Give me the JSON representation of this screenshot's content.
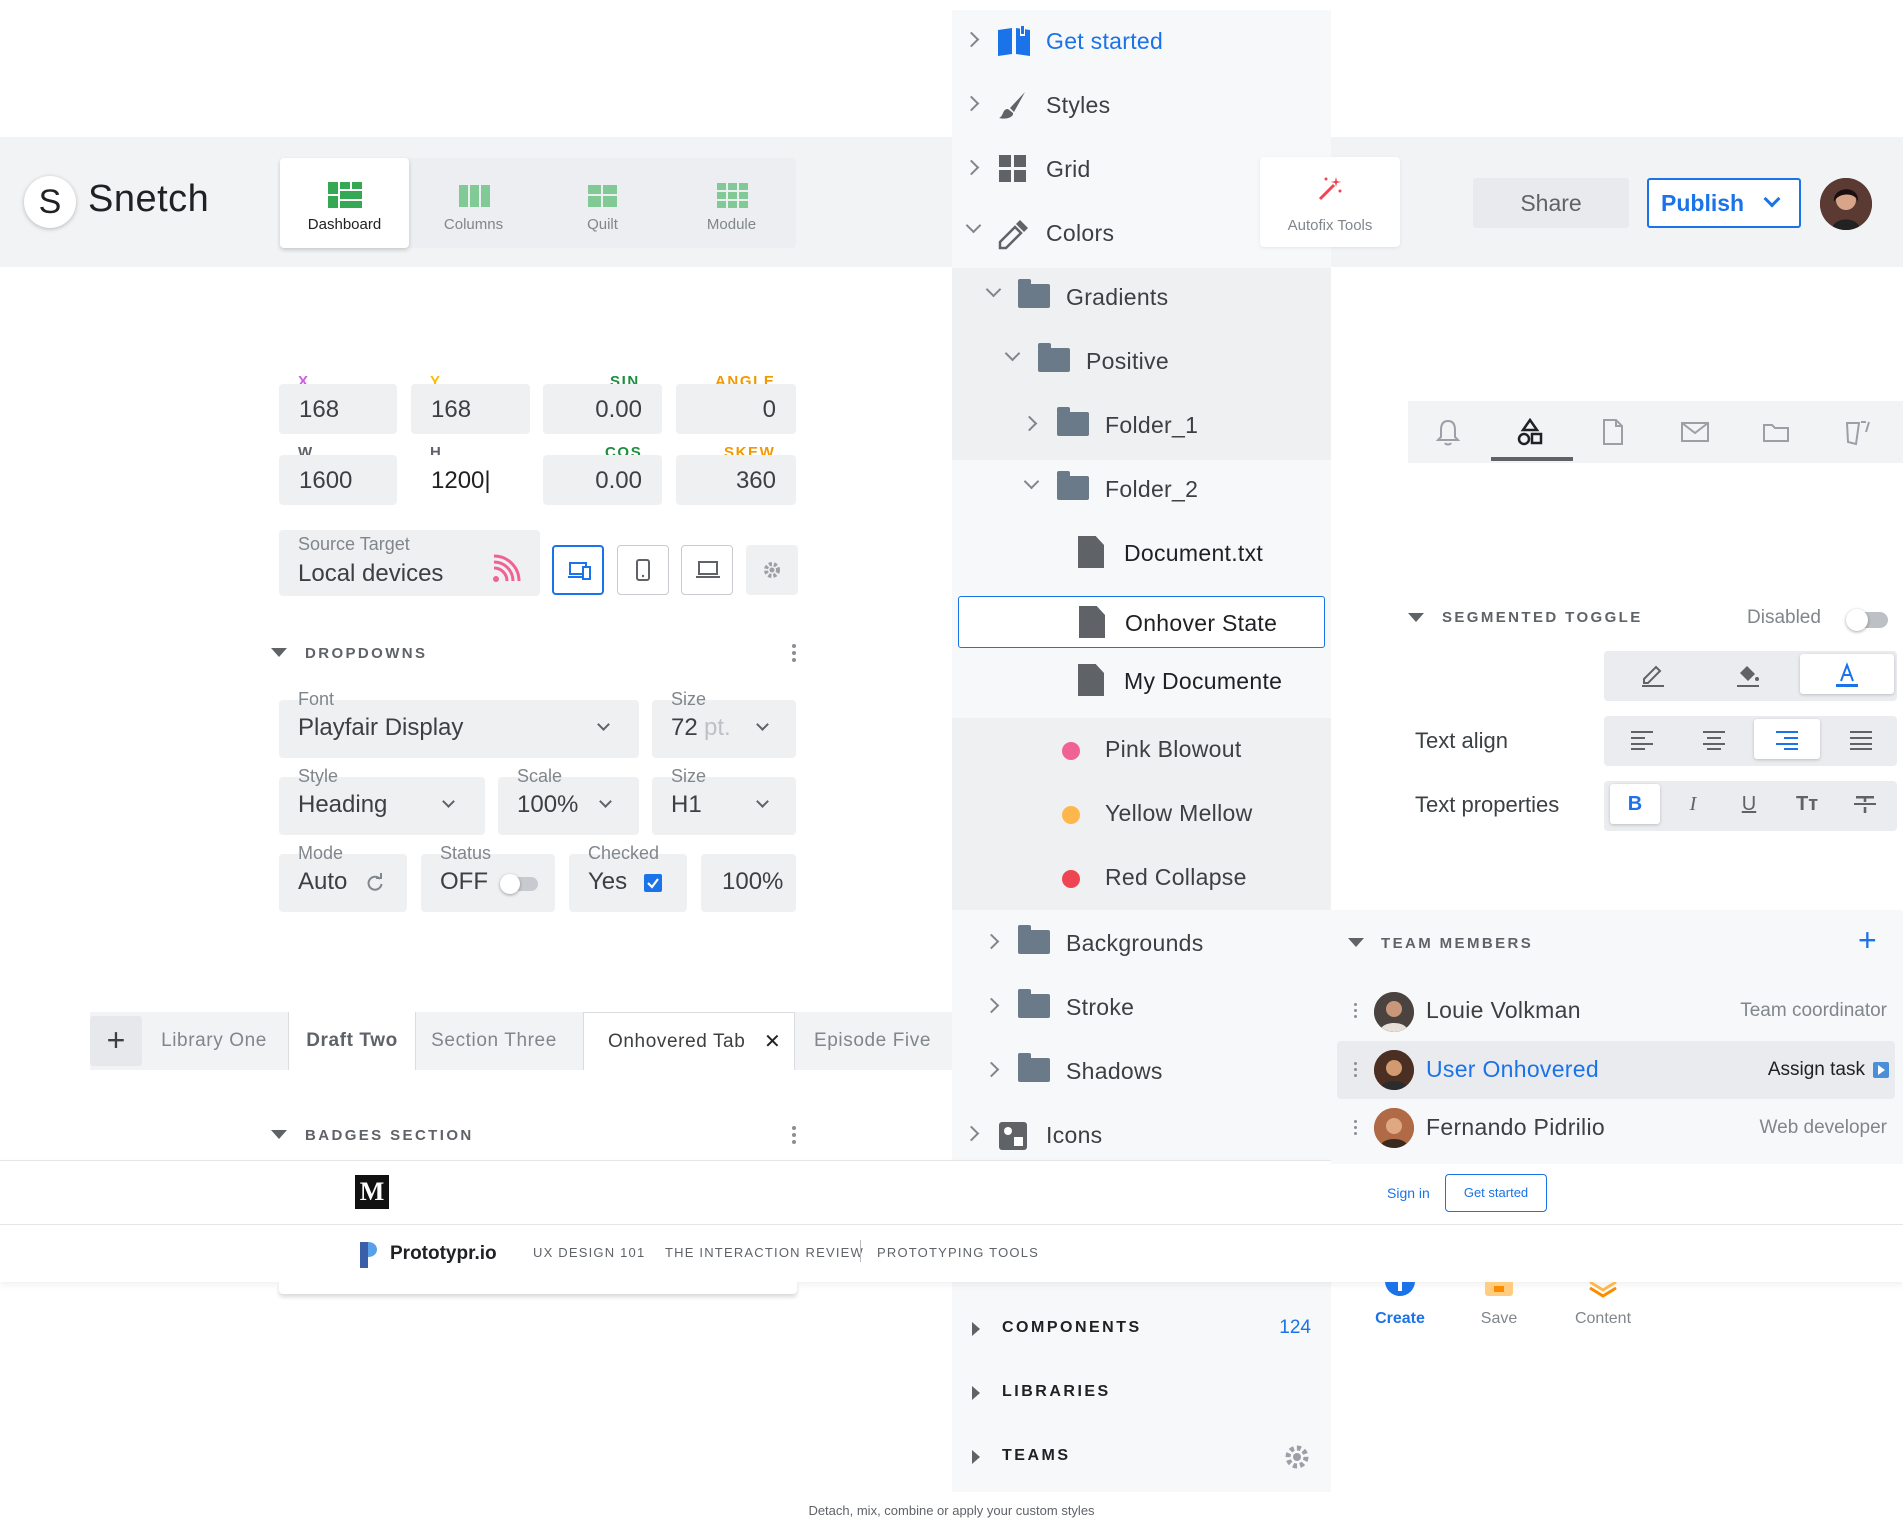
{
  "app": {
    "logo_letter": "S",
    "name": "Snetch"
  },
  "view_tabs": [
    {
      "label": "Dashboard",
      "icon": "dashboard-icon"
    },
    {
      "label": "Columns",
      "icon": "columns-icon"
    },
    {
      "label": "Quilt",
      "icon": "quilt-icon"
    },
    {
      "label": "Module",
      "icon": "module-icon"
    }
  ],
  "transform": {
    "x_label": "X",
    "x": "168",
    "y_label": "Y",
    "y": "168",
    "sin_label": "SIN",
    "sin": "0.00",
    "angle_label": "ANGLE",
    "angle": "0",
    "w_label": "W",
    "w": "1600",
    "h_label": "H",
    "h": "1200|",
    "cos_label": "COS",
    "cos": "0.00",
    "skew_label": "SKEW",
    "skew": "360"
  },
  "source": {
    "label": "Source Target",
    "value": "Local devices"
  },
  "dropdowns": {
    "title": "DROPDOWNS",
    "font_label": "Font",
    "font": "Playfair Display",
    "size_label": "Size",
    "size": "72",
    "size_unit": "pt.",
    "style_label": "Style",
    "style": "Heading",
    "scale_label": "Scale",
    "scale": "100%",
    "size2_label": "Size",
    "size2": "H1",
    "mode_label": "Mode",
    "mode": "Auto",
    "status_label": "Status",
    "status": "OFF",
    "checked_label": "Checked",
    "checked": "Yes",
    "percent": "100%"
  },
  "tabs": {
    "items": [
      "Library One",
      "Draft Two",
      "Section Three",
      "Onhovered Tab",
      "Episode Five"
    ],
    "close": "✕",
    "add": "+"
  },
  "badges": {
    "title": "BADGES SECTION"
  },
  "tree": {
    "get_started": "Get started",
    "styles": "Styles",
    "grid": "Grid",
    "colors": "Colors",
    "gradients": "Gradients",
    "positive": "Positive",
    "folder1": "Folder_1",
    "folder2": "Folder_2",
    "doc_txt": "Document.txt",
    "onhover": "Onhover State",
    "my_doc": "My Documente",
    "pink": "Pink Blowout",
    "yellow": "Yellow Mellow",
    "red": "Red Collapse",
    "backgrounds": "Backgrounds",
    "stroke": "Stroke",
    "shadows": "Shadows",
    "icons": "Icons",
    "components": "COMPONENTS",
    "components_count": "124",
    "libraries": "LIBRARIES",
    "teams": "TEAMS"
  },
  "colors": {
    "pink": "#f06292",
    "yellow": "#ffb74d",
    "red": "#ef4452",
    "blue": "#1a73e8",
    "green": "#34a853"
  },
  "toolbar": {
    "autofix": "Autofix Tools",
    "share": "Share",
    "publish": "Publish"
  },
  "segmented": {
    "title": "SEGMENTED TOGGLE",
    "disabled": "Disabled",
    "text_align": "Text align",
    "text_props": "Text properties",
    "bold": "B",
    "italic": "I",
    "underline": "U",
    "size": "Tт"
  },
  "team": {
    "title": "TEAM MEMBERS",
    "add": "+",
    "members": [
      {
        "name": "Louie Volkman",
        "role": "Team coordinator"
      },
      {
        "name": "User Onhovered",
        "role": "Assign task"
      },
      {
        "name": "Fernando Pidrilio",
        "role": "Web developer"
      }
    ]
  },
  "actions": [
    "Create",
    "Save",
    "Content"
  ],
  "medium": {
    "logo": "M",
    "sign_in": "Sign in",
    "get_started": "Get started",
    "brand": "Prototypr.io",
    "nav": [
      "UX DESIGN 101",
      "THE INTERACTION REVIEW",
      "PROTOTYPING TOOLS"
    ]
  },
  "footer": "Detach, mix, combine or apply your custom styles"
}
